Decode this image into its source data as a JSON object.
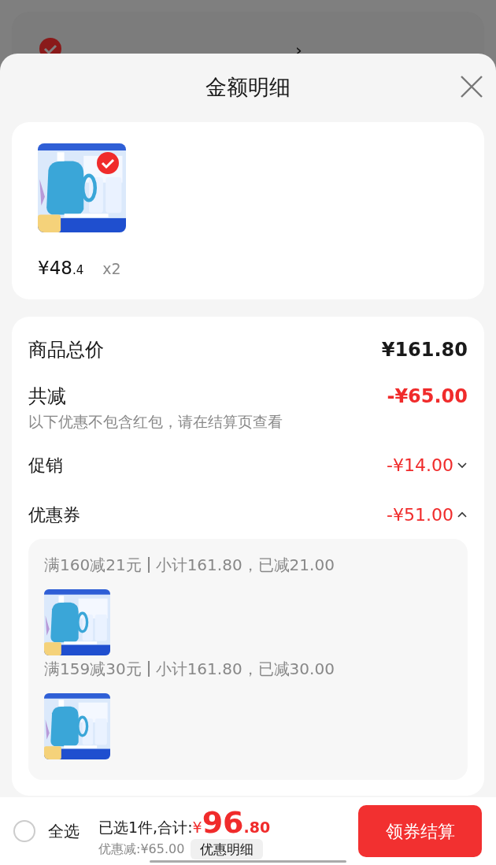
{
  "background_store": {
    "arrow": "›",
    "checked": true
  },
  "sheet": {
    "title": "金额明细"
  },
  "product": {
    "selected": true,
    "price_int": "¥48",
    "price_dec": ".4",
    "quantity": "x2"
  },
  "summary": {
    "total_label": "商品总价",
    "total_value": "¥161.80",
    "reduction_label": "共减",
    "reduction_value": "-¥65.00",
    "note": "以下优惠不包含红包，请在结算页查看"
  },
  "discounts": [
    {
      "label": "促销",
      "value": "-¥14.00",
      "expanded": false
    },
    {
      "label": "优惠券",
      "value": "-¥51.00",
      "expanded": true
    }
  ],
  "coupons": [
    {
      "rule": "满160减21元",
      "detail": "小计161.80，已减21.00"
    },
    {
      "rule": "满159减30元",
      "detail": "小计161.80，已减30.00"
    }
  ],
  "footer": {
    "select_all_label": "全选",
    "select_all_checked": false,
    "selected_text": "已选1件,合计:",
    "currency": "¥",
    "total_int": "96",
    "total_dec": ".80",
    "discount_text": "优惠减:¥65.00",
    "detail_button": "优惠明细",
    "checkout_button": "领券结算"
  }
}
